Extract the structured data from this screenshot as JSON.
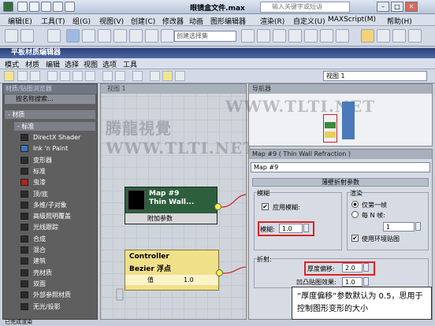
{
  "app": {
    "title": "眼镜盒文件.max",
    "search_placeholder": "输入关键字或短语"
  },
  "menubar": [
    "编辑(E)",
    "工具(T)",
    "组(G)",
    "视图(V)",
    "创建(C)",
    "修改器",
    "动画",
    "图形编辑器",
    "渲染(R)",
    "自定义(U)",
    "MAXScript(M)",
    "帮助(H)"
  ],
  "toolbar": {
    "selection_filter": "创建选择集"
  },
  "material_editor": {
    "title": "平板材质编辑器",
    "menu": [
      "模式",
      "材质",
      "编辑",
      "选择",
      "视图",
      "选项",
      "工具"
    ],
    "view_select": "视图 1"
  },
  "browser": {
    "header": "材质/贴图浏览器",
    "search": "按名称搜索...",
    "category": "- 材质",
    "subcategory": "- 标准",
    "items": [
      {
        "label": "DirectX Shader",
        "color": "#2b2b2b"
      },
      {
        "label": "Ink 'n Paint",
        "color": "#3a77c9"
      },
      {
        "label": "变形器",
        "color": "#2b2b2b"
      },
      {
        "label": "标准",
        "color": "#2b2b2b"
      },
      {
        "label": "虫漆",
        "color": "#b22222"
      },
      {
        "label": "顶/底",
        "color": "#2b2b2b"
      },
      {
        "label": "多维/子对象",
        "color": "#2b2b2b"
      },
      {
        "label": "高级照明覆盖",
        "color": "#2b2b2b"
      },
      {
        "label": "光线跟踪",
        "color": "#2b2b2b"
      },
      {
        "label": "合成",
        "color": "#2b2b2b"
      },
      {
        "label": "混合",
        "color": "#2b2b2b"
      },
      {
        "label": "建筑",
        "color": "#2b2b2b"
      },
      {
        "label": "壳材质",
        "color": "#2b2b2b"
      },
      {
        "label": "双面",
        "color": "#2b2b2b"
      },
      {
        "label": "外部参照材质",
        "color": "#2b2b2b"
      },
      {
        "label": "无光/投影",
        "color": "#2b2b2b"
      }
    ]
  },
  "view": {
    "tab": "视图 1",
    "node_map": {
      "title": "Map #9",
      "subtitle": "Thin Wall...",
      "foot": "附加参数"
    },
    "node_controller": {
      "title": "Controller",
      "subtitle": "Bezier 浮点",
      "param": "值",
      "value": "1.0"
    }
  },
  "navigator": {
    "header": "导航器"
  },
  "properties": {
    "header": "Map #9  ( Thin Wall Refraction )",
    "name": "Map #9",
    "rollout": "薄壁折射参数",
    "blur": {
      "group": "模糊",
      "apply_label": "应用模糊:",
      "apply_checked": true,
      "blur_label": "模糊:",
      "blur_value": "1.0"
    },
    "render": {
      "group": "渲染",
      "first_frame": "仅第一帧",
      "every_n": "每 N 帧:",
      "n_value": "1",
      "env_map": "使用环境贴图",
      "env_checked": true
    },
    "refraction": {
      "group": "折射:",
      "thickness_label": "厚度偏移:",
      "thickness_value": "2.0",
      "bump_label": "凹凸贴图效果:",
      "bump_value": "1.0"
    }
  },
  "status": "已完成渲染",
  "caption": "“厚度偏移”参数默认为 0.5，思用于控制图形变形的大小",
  "watermark": "腾龍視覺 WWW.TLTI.NET"
}
